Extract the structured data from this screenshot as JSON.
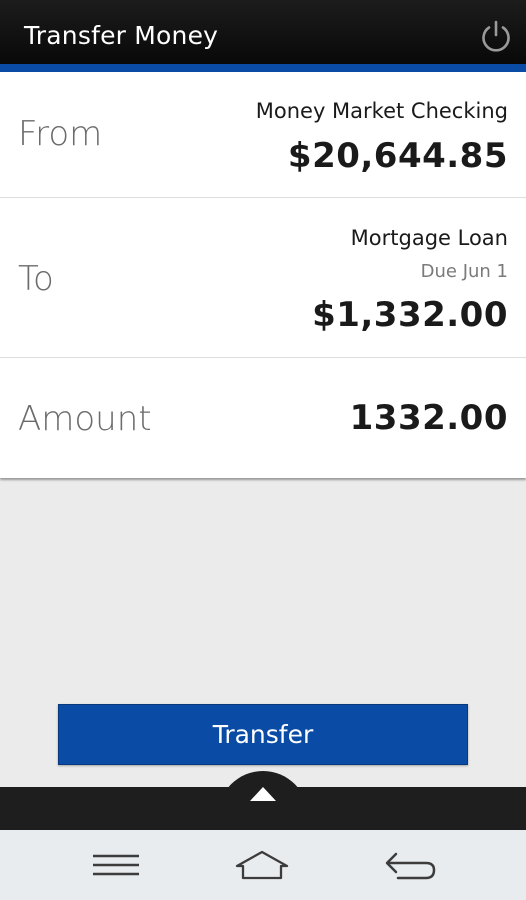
{
  "header": {
    "title": "Transfer Money",
    "power_icon": "power-icon"
  },
  "from": {
    "label": "From",
    "account": "Money Market Checking",
    "balance": "$20,644.85"
  },
  "to": {
    "label": "To",
    "account": "Mortgage Loan",
    "due": "Due Jun 1",
    "balance": "$1,332.00"
  },
  "amount": {
    "label": "Amount",
    "value": "1332.00"
  },
  "transfer_button": {
    "label": "Transfer"
  },
  "colors": {
    "accent": "#0a4ca5",
    "header_bg": "#0d0d0d",
    "body_bg": "#ebebeb"
  },
  "navbar": {
    "icons": [
      "menu-icon",
      "home-icon",
      "back-icon"
    ]
  }
}
